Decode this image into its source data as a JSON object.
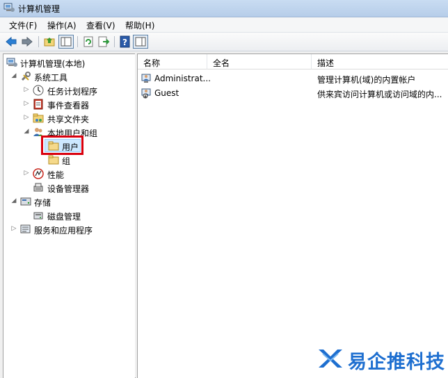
{
  "window": {
    "title": "计算机管理"
  },
  "menu": [
    "文件(F)",
    "操作(A)",
    "查看(V)",
    "帮助(H)"
  ],
  "toolbar": {
    "icons": [
      "back-arrow-icon",
      "forward-arrow-icon",
      "up-folder-icon",
      "show-hide-tree-icon",
      "refresh-icon",
      "export-icon",
      "help-icon",
      "properties-icon"
    ]
  },
  "tree": {
    "root": "计算机管理(本地)",
    "system_tools": "系统工具",
    "task_scheduler": "任务计划程序",
    "event_viewer": "事件查看器",
    "shared_folders": "共享文件夹",
    "local_users_groups": "本地用户和组",
    "users": "用户",
    "groups": "组",
    "performance": "性能",
    "device_manager": "设备管理器",
    "storage": "存储",
    "disk_management": "磁盘管理",
    "services_apps": "服务和应用程序"
  },
  "list": {
    "columns": [
      "名称",
      "全名",
      "描述"
    ],
    "rows": [
      {
        "name": "Administrat...",
        "fullname": "",
        "description": "管理计算机(域)的内置帐户"
      },
      {
        "name": "Guest",
        "fullname": "",
        "description": "供来宾访问计算机或访问域的内..."
      }
    ]
  },
  "watermark": {
    "text": "易企推科技"
  },
  "colors": {
    "selection_highlight": "#d9000d",
    "watermark": "#1e6fd0"
  }
}
